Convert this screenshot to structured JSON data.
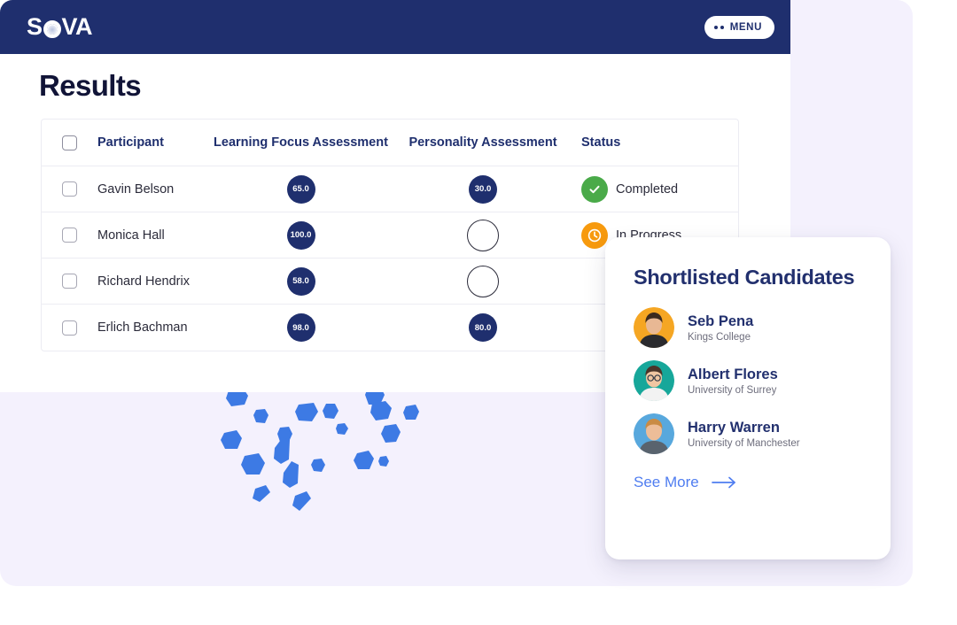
{
  "brand": {
    "logo_text_before": "S",
    "logo_text_after": "VA",
    "logo_name": "SOVA"
  },
  "topbar": {
    "menu_label": "MENU"
  },
  "page": {
    "title": "Results"
  },
  "table": {
    "columns": [
      "Participant",
      "Learning Focus Assessment",
      "Personality Assessment",
      "Status"
    ],
    "rows": [
      {
        "name": "Gavin Belson",
        "learning_focus": "65.0",
        "personality": "30.0",
        "status": "Completed",
        "status_state": "completed"
      },
      {
        "name": "Monica Hall",
        "learning_focus": "100.0",
        "personality": "",
        "status": "In Progress",
        "status_state": "in-progress"
      },
      {
        "name": "Richard Hendrix",
        "learning_focus": "58.0",
        "personality": "",
        "status": "",
        "status_state": "none"
      },
      {
        "name": "Erlich Bachman",
        "learning_focus": "98.0",
        "personality": "80.0",
        "status": "",
        "status_state": "none"
      }
    ]
  },
  "shortlist_card": {
    "title": "Shortlisted Candidates",
    "candidates": [
      {
        "name": "Seb Pena",
        "org": "Kings College",
        "avatar_bg": "#f5a623"
      },
      {
        "name": "Albert Flores",
        "org": "University of Surrey",
        "avatar_bg": "#17a79a"
      },
      {
        "name": "Harry Warren",
        "org": "University of Manchester",
        "avatar_bg": "#58a8dd"
      }
    ],
    "see_more_label": "See More"
  },
  "colors": {
    "navy": "#1f2f6e",
    "title_navy": "#111437",
    "badge_navy": "#1f2f6e",
    "completed_green": "#4aaa49",
    "in_progress_orange": "#f79a0e",
    "link_blue": "#4f7df0",
    "confetti_blue": "#3d7ae4",
    "lavender_bg": "#f4f1fd"
  }
}
